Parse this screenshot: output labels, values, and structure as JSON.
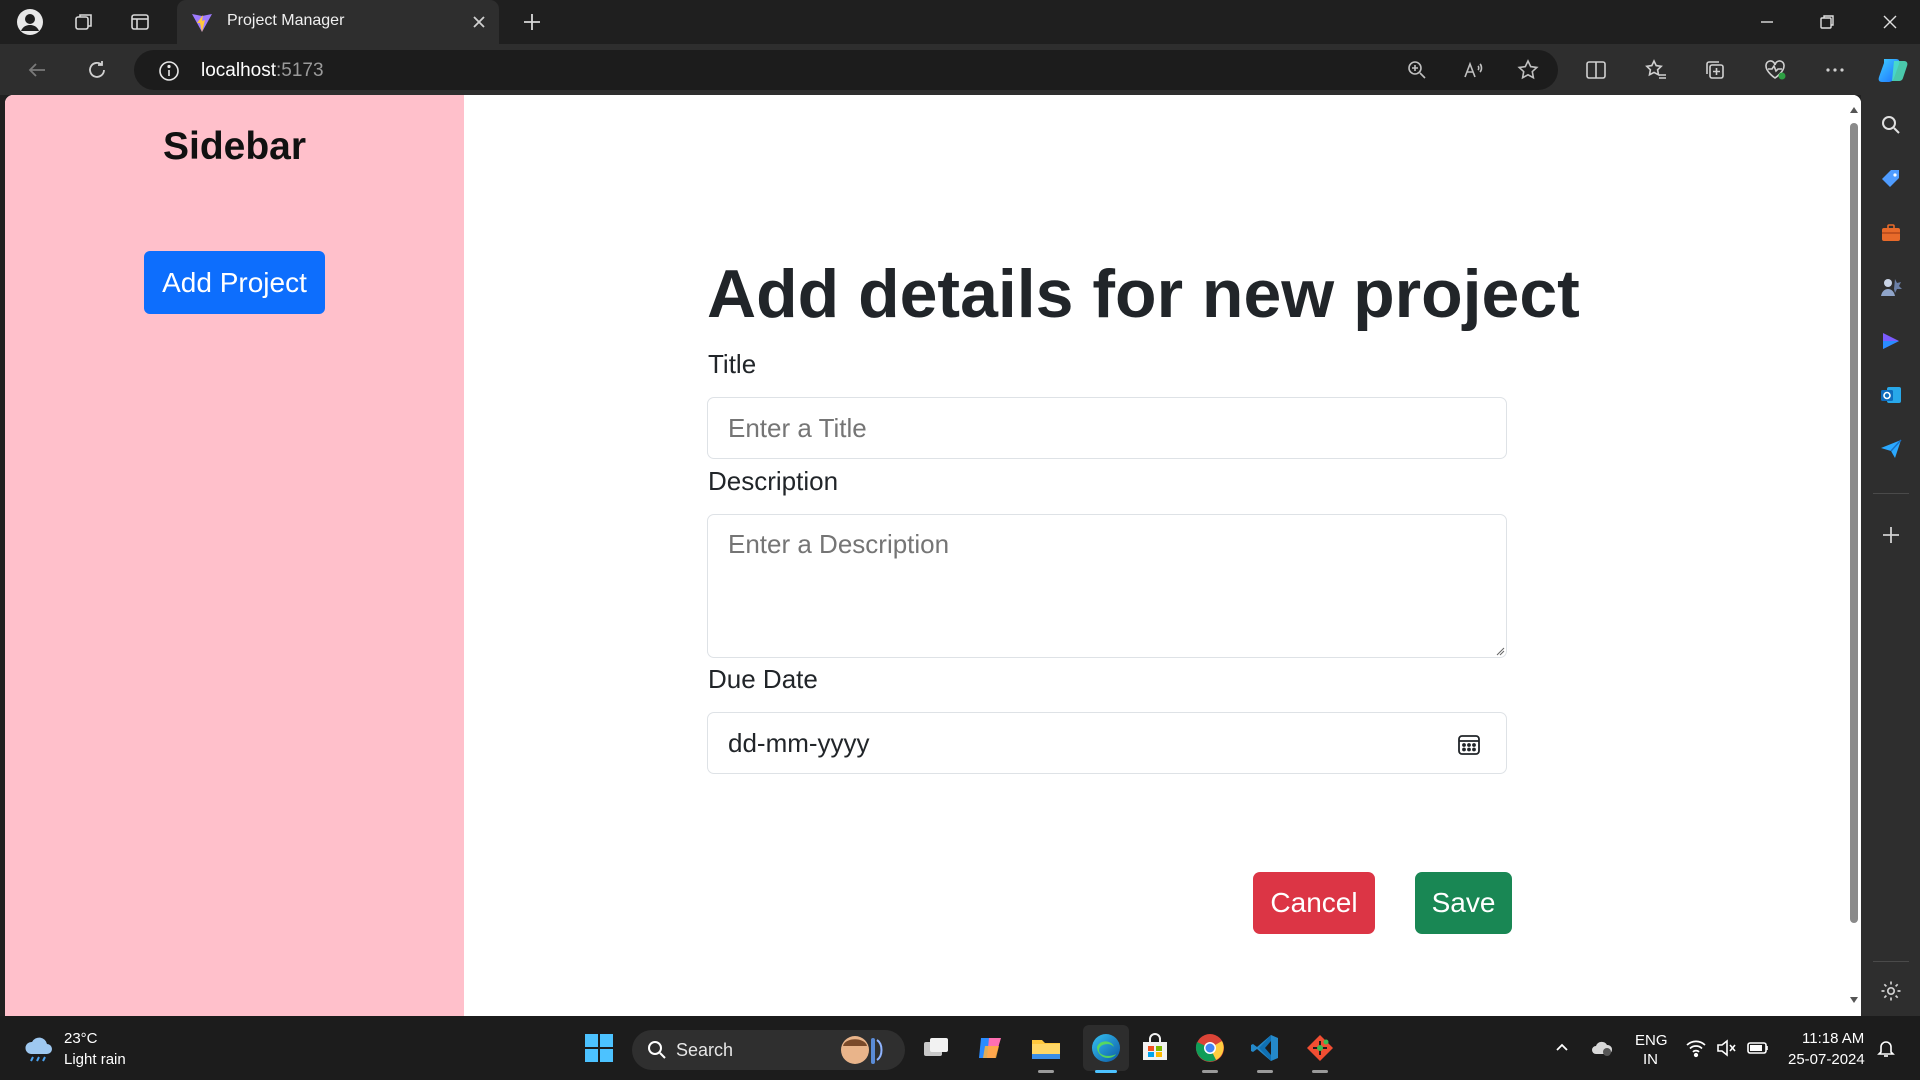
{
  "browser": {
    "tab_title": "Project Manager",
    "url_host": "localhost",
    "url_port": ":5173"
  },
  "page": {
    "sidebar_title": "Sidebar",
    "add_project_label": "Add Project",
    "form": {
      "heading": "Add details for new project",
      "title_label": "Title",
      "title_placeholder": "Enter a Title",
      "description_label": "Description",
      "description_placeholder": "Enter a Description",
      "due_date_label": "Due Date",
      "due_date_value": "dd-mm-yyyy",
      "cancel_label": "Cancel",
      "save_label": "Save"
    }
  },
  "taskbar": {
    "weather_temp": "23°C",
    "weather_desc": "Light rain",
    "search_label": "Search",
    "lang_line1": "ENG",
    "lang_line2": "IN",
    "time": "11:18 AM",
    "date": "25-07-2024"
  },
  "colors": {
    "sidebar_bg": "#ffc0cb",
    "primary": "#0d6efd",
    "danger": "#dc3545",
    "success": "#198754"
  }
}
